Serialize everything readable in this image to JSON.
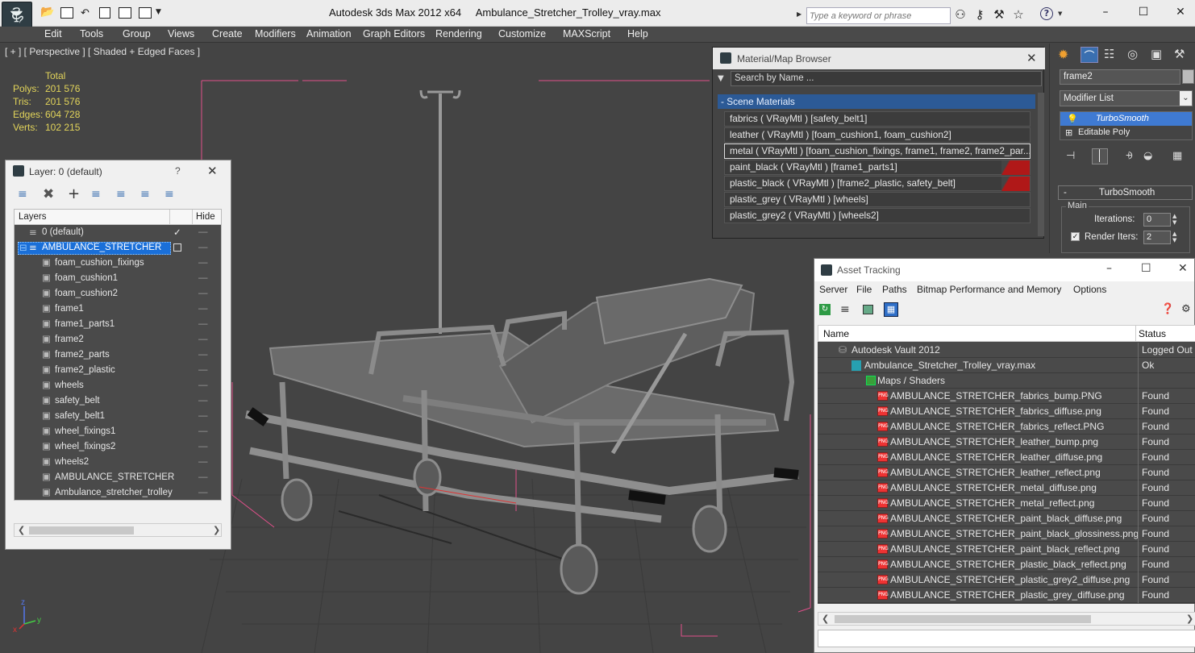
{
  "window": {
    "app_title": "Autodesk 3ds Max  2012 x64",
    "file_title": "Ambulance_Stretcher_Trolley_vray.max",
    "search_placeholder": "Type a keyword or phrase"
  },
  "menu": [
    "Edit",
    "Tools",
    "Group",
    "Views",
    "Create",
    "Modifiers",
    "Animation",
    "Graph Editors",
    "Rendering",
    "Customize",
    "MAXScript",
    "Help"
  ],
  "viewport": {
    "label": "[ + ] [ Perspective ] [ Shaded + Edged Faces ]",
    "stats_header": "Total",
    "stats": [
      {
        "label": "Polys:",
        "value": "201 576"
      },
      {
        "label": "Tris:",
        "value": "201 576"
      },
      {
        "label": "Edges:",
        "value": "604 728"
      },
      {
        "label": "Verts:",
        "value": "102 215"
      }
    ],
    "axis_z": "z",
    "axis_y": "y",
    "axis_x": "x"
  },
  "layer_panel": {
    "title": "Layer: 0 (default)",
    "help": "?",
    "col_layers": "Layers",
    "col_hide": "Hide",
    "default_layer": "0 (default)",
    "selected_layer": "AMBULANCE_STRETCHER",
    "objects": [
      "foam_cushion_fixings",
      "foam_cushion1",
      "foam_cushion2",
      "frame1",
      "frame1_parts1",
      "frame2",
      "frame2_parts",
      "frame2_plastic",
      "wheels",
      "safety_belt",
      "safety_belt1",
      "wheel_fixings1",
      "wheel_fixings2",
      "wheels2",
      "AMBULANCE_STRETCHER",
      "Ambulance_stretcher_trolley"
    ]
  },
  "material_browser": {
    "title": "Material/Map Browser",
    "search_placeholder": "Search by Name ...",
    "section": "- Scene Materials",
    "materials": [
      "fabrics  ( VRayMtl ) [safety_belt1]",
      "leather  ( VRayMtl ) [foam_cushion1, foam_cushion2]",
      "metal  ( VRayMtl ) [foam_cushion_fixings, frame1, frame2, frame2_par...",
      "paint_black  ( VRayMtl ) [frame1_parts1]",
      "plastic_black  ( VRayMtl ) [frame2_plastic, safety_belt]",
      "plastic_grey  ( VRayMtl ) [wheels]",
      "plastic_grey2  ( VRayMtl ) [wheels2]"
    ]
  },
  "command_panel": {
    "object_name": "frame2",
    "modifier_list": "Modifier List",
    "stack": [
      "TurboSmooth",
      "Editable Poly"
    ],
    "rollout_title": "TurboSmooth",
    "group_main": "Main",
    "iterations_label": "Iterations:",
    "iterations_value": "0",
    "render_iters_label": "Render Iters:",
    "render_iters_value": "2"
  },
  "asset_tracking": {
    "title": "Asset Tracking",
    "menu": [
      "Server",
      "File",
      "Paths",
      "Bitmap Performance and Memory",
      "Options"
    ],
    "col_name": "Name",
    "col_status": "Status",
    "vault": {
      "name": "Autodesk Vault 2012",
      "status": "Logged Out ..."
    },
    "file": {
      "name": "Ambulance_Stretcher_Trolley_vray.max",
      "status": "Ok"
    },
    "group": "Maps / Shaders",
    "maps": [
      {
        "name": "AMBULANCE_STRETCHER_fabrics_bump.PNG",
        "status": "Found"
      },
      {
        "name": "AMBULANCE_STRETCHER_fabrics_diffuse.png",
        "status": "Found"
      },
      {
        "name": "AMBULANCE_STRETCHER_fabrics_reflect.PNG",
        "status": "Found"
      },
      {
        "name": "AMBULANCE_STRETCHER_leather_bump.png",
        "status": "Found"
      },
      {
        "name": "AMBULANCE_STRETCHER_leather_diffuse.png",
        "status": "Found"
      },
      {
        "name": "AMBULANCE_STRETCHER_leather_reflect.png",
        "status": "Found"
      },
      {
        "name": "AMBULANCE_STRETCHER_metal_diffuse.png",
        "status": "Found"
      },
      {
        "name": "AMBULANCE_STRETCHER_metal_reflect.png",
        "status": "Found"
      },
      {
        "name": "AMBULANCE_STRETCHER_paint_black_diffuse.png",
        "status": "Found"
      },
      {
        "name": "AMBULANCE_STRETCHER_paint_black_glossiness.png",
        "status": "Found"
      },
      {
        "name": "AMBULANCE_STRETCHER_paint_black_reflect.png",
        "status": "Found"
      },
      {
        "name": "AMBULANCE_STRETCHER_plastic_black_reflect.png",
        "status": "Found"
      },
      {
        "name": "AMBULANCE_STRETCHER_plastic_grey2_diffuse.png",
        "status": "Found"
      },
      {
        "name": "AMBULANCE_STRETCHER_plastic_grey_diffuse.png",
        "status": "Found"
      }
    ],
    "png_label": "PNG"
  },
  "colors": {
    "stat_text": "#e2d45a",
    "selection": "#1a6fd8",
    "bounding_box": "#e0508a"
  }
}
